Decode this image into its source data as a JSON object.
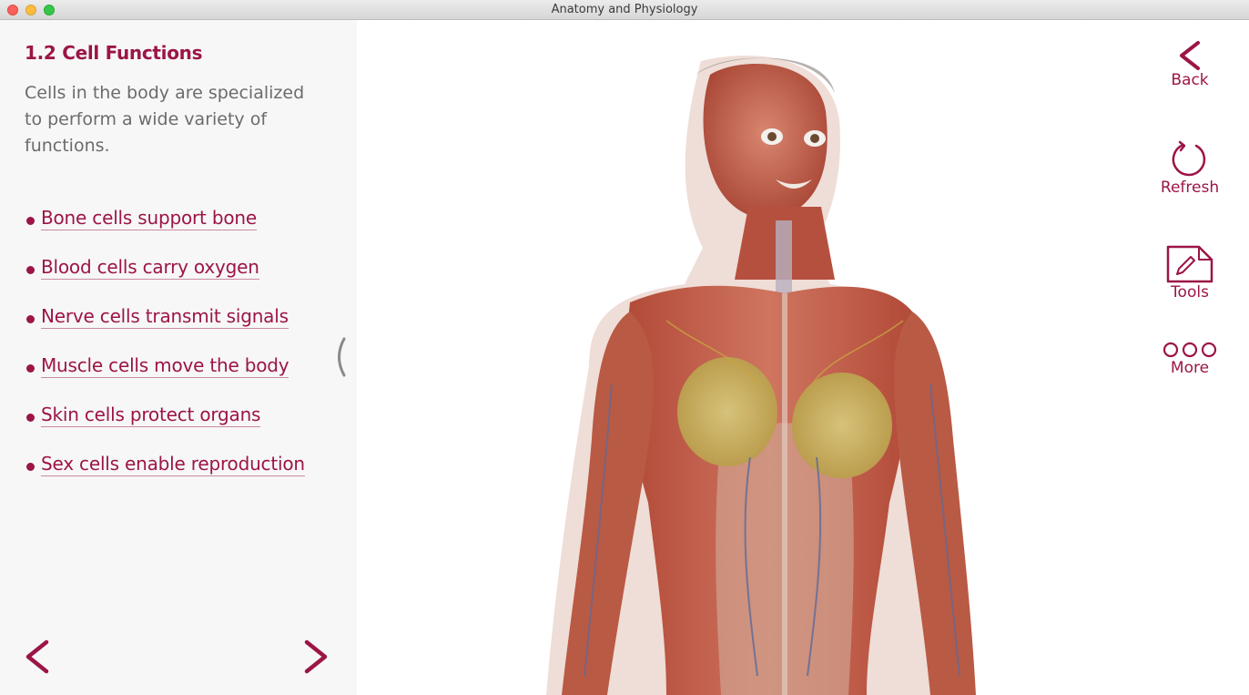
{
  "window": {
    "title": "Anatomy and Physiology"
  },
  "lesson": {
    "title": "1.2 Cell Functions",
    "intro": "Cells in the body are specialized to perform a wide variety of functions.",
    "topics": [
      {
        "label": "Bone cells support bone"
      },
      {
        "label": "Blood cells carry oxygen"
      },
      {
        "label": "Nerve cells transmit signals"
      },
      {
        "label": "Muscle cells move the body"
      },
      {
        "label": "Skin cells protect organs"
      },
      {
        "label": "Sex cells enable reproduction"
      }
    ]
  },
  "toolbar": {
    "back_label": "Back",
    "refresh_label": "Refresh",
    "tools_label": "Tools",
    "more_label": "More"
  },
  "icons": {
    "back": "chevron-left-icon",
    "refresh": "refresh-icon",
    "tools": "pencil-document-icon",
    "more": "three-circles-icon",
    "prev": "chevron-left-icon",
    "next": "chevron-right-icon",
    "collapse": "collapse-panel-icon"
  },
  "colors": {
    "accent": "#9c1547",
    "sidebar_bg": "#f7f7f7",
    "intro_text": "#6b6b6b"
  }
}
